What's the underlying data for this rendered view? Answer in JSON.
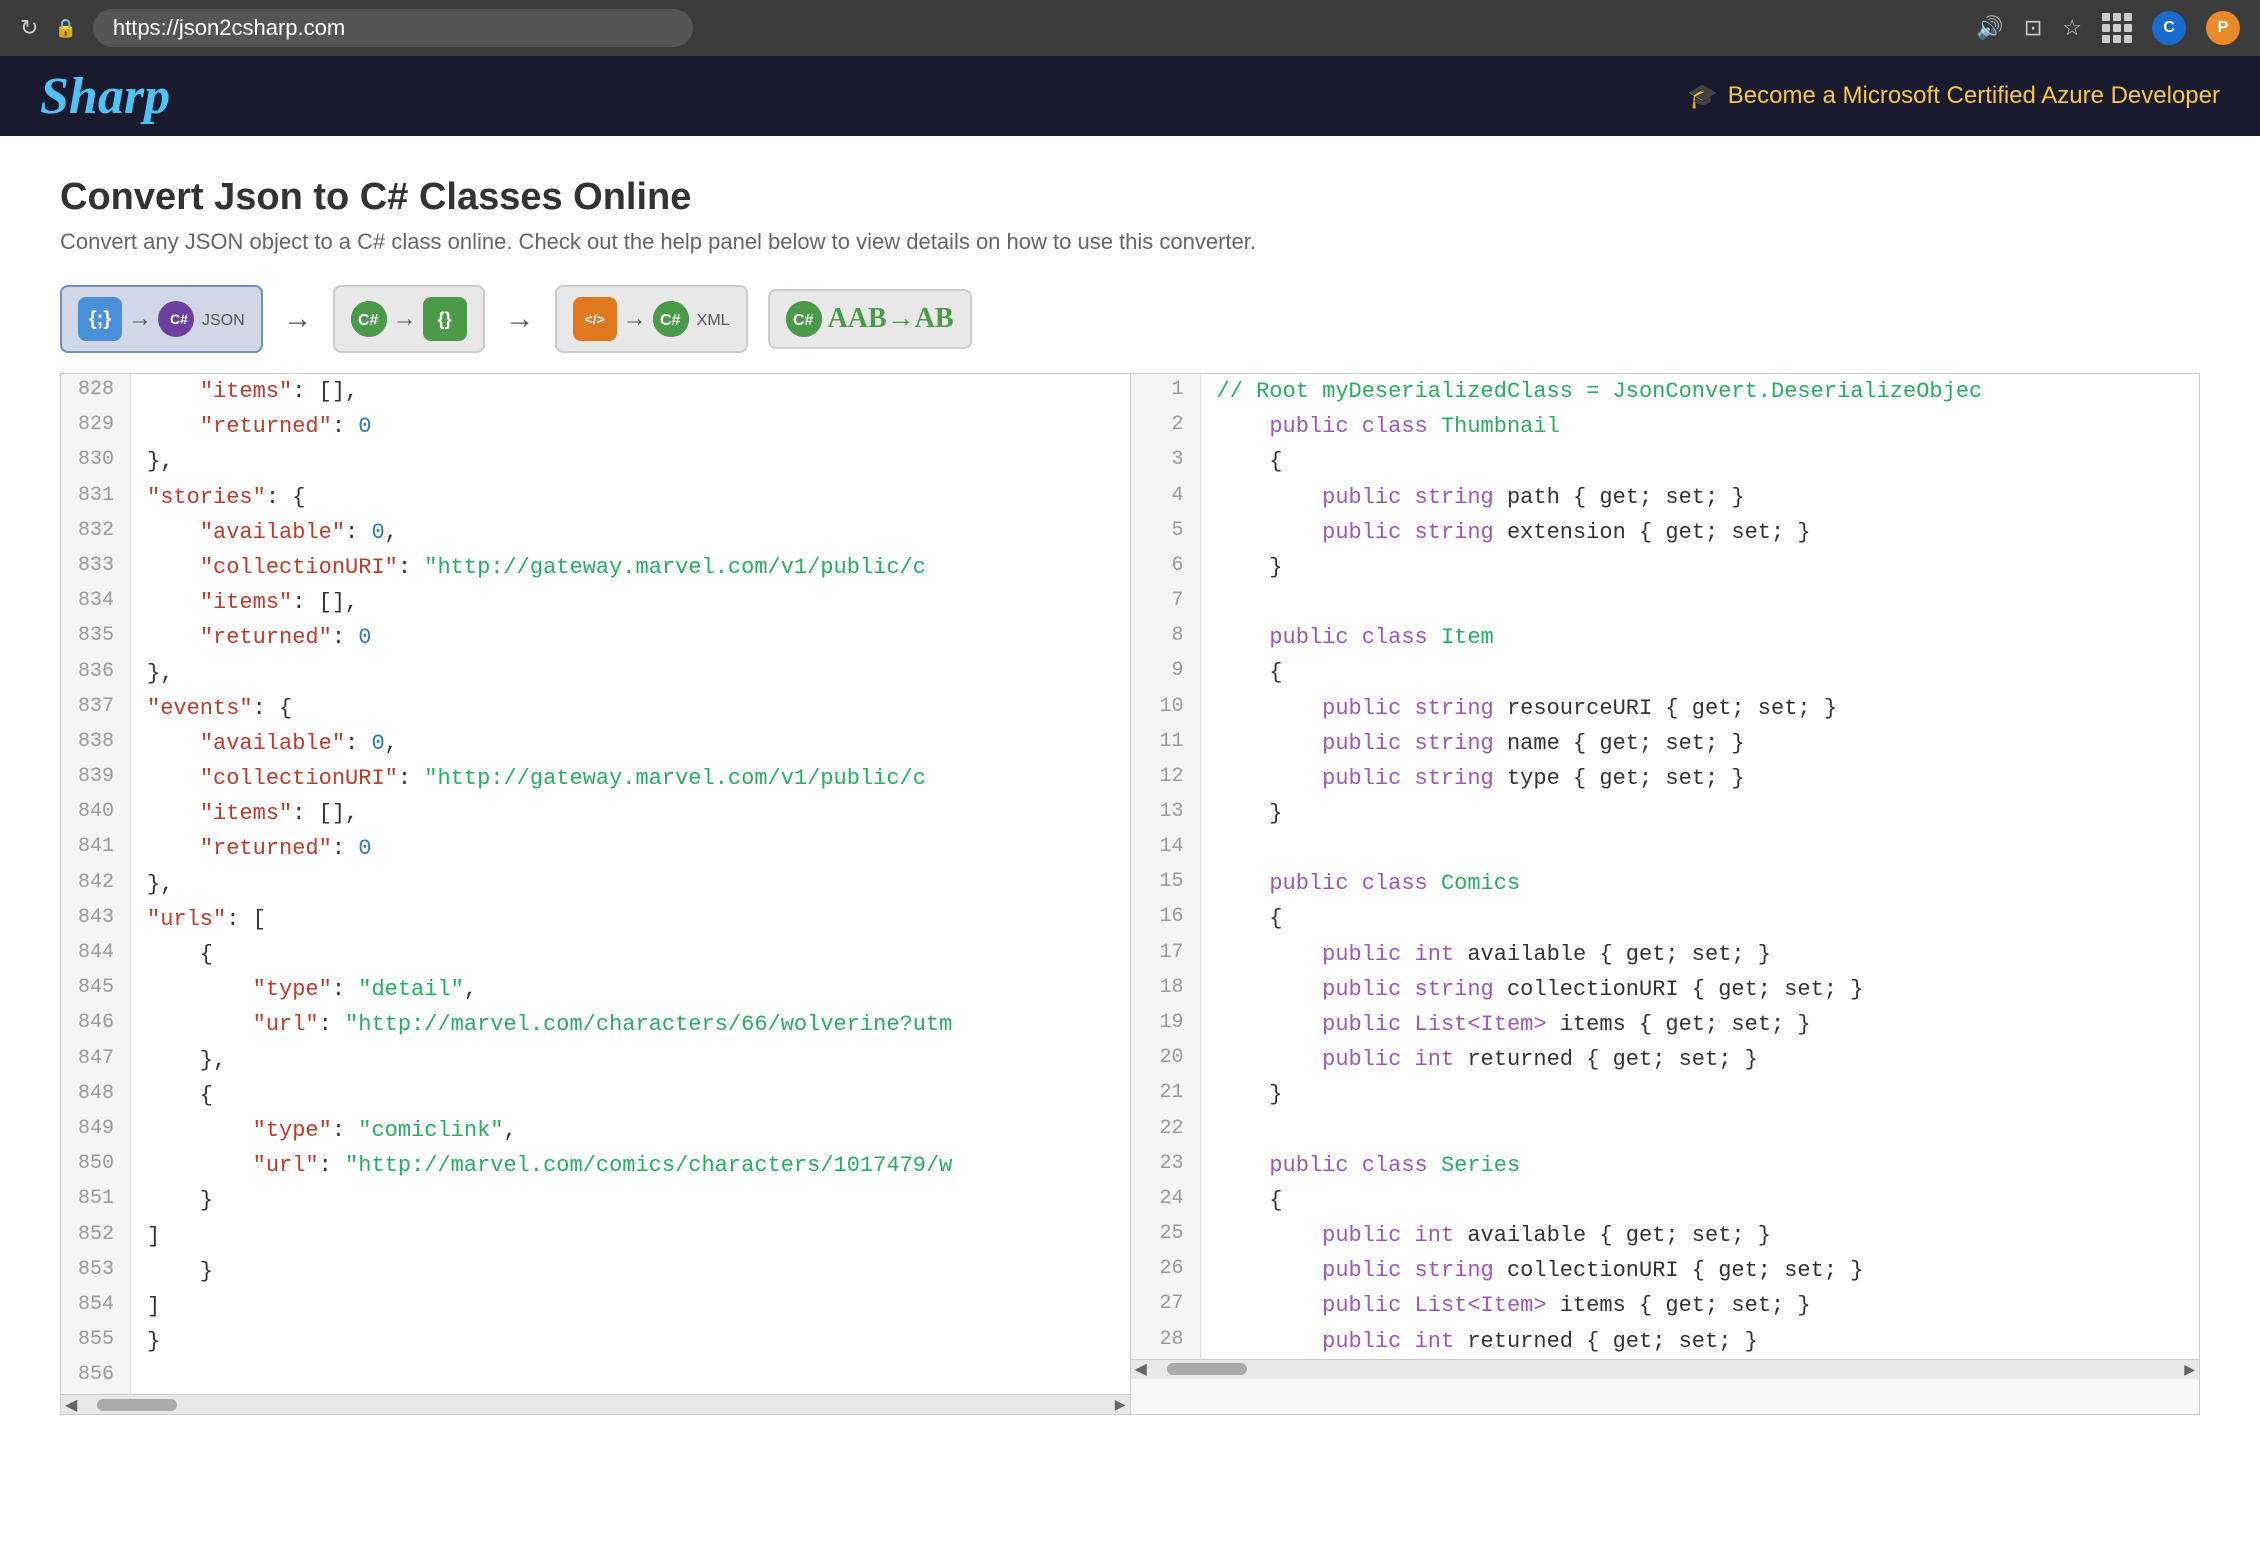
{
  "browser": {
    "url": "https://json2csharp.com",
    "refresh_icon": "↻",
    "lock_icon": "🔒",
    "tab_icons": [
      "⭐",
      "⋮⋮⋮"
    ],
    "avatar_c_label": "C",
    "avatar_p_label": "P"
  },
  "header": {
    "logo": "Sharp",
    "promo_icon": "🎓",
    "promo_text": "Become a Microsoft Certified Azure Developer"
  },
  "page": {
    "title": "Convert Json to C# Classes Online",
    "subtitle": "Convert any JSON object to a C# class online. Check out the help panel below to view details on how to use this converter."
  },
  "toolbar": {
    "btn1_label": "JSON",
    "btn1_arrow": "→",
    "btn2_label": "C#",
    "btn2_arrow": "→",
    "btn3_label": "C#",
    "btn4_label": "XML",
    "btn4_arrow": "→",
    "btn5_label": "C#",
    "rename_label": "AAB→AB"
  },
  "json_lines": [
    {
      "num": "828",
      "code": "    \"items\": [],"
    },
    {
      "num": "829",
      "code": "    \"returned\": 0"
    },
    {
      "num": "830",
      "code": "},"
    },
    {
      "num": "831",
      "code": "\"stories\": {"
    },
    {
      "num": "832",
      "code": "    \"available\": 0,"
    },
    {
      "num": "833",
      "code": "    \"collectionURI\": \"http://gateway.marvel.com/v1/public/c"
    },
    {
      "num": "834",
      "code": "    \"items\": [],"
    },
    {
      "num": "835",
      "code": "    \"returned\": 0"
    },
    {
      "num": "836",
      "code": "},"
    },
    {
      "num": "837",
      "code": "\"events\": {"
    },
    {
      "num": "838",
      "code": "    \"available\": 0,"
    },
    {
      "num": "839",
      "code": "    \"collectionURI\": \"http://gateway.marvel.com/v1/public/c"
    },
    {
      "num": "840",
      "code": "    \"items\": [],"
    },
    {
      "num": "841",
      "code": "    \"returned\": 0"
    },
    {
      "num": "842",
      "code": "},"
    },
    {
      "num": "843",
      "code": "\"urls\": ["
    },
    {
      "num": "844",
      "code": "    {"
    },
    {
      "num": "845",
      "code": "        \"type\": \"detail\","
    },
    {
      "num": "846",
      "code": "        \"url\": \"http://marvel.com/characters/66/wolverine?utm"
    },
    {
      "num": "847",
      "code": "    },"
    },
    {
      "num": "848",
      "code": "    {"
    },
    {
      "num": "849",
      "code": "        \"type\": \"comiclink\","
    },
    {
      "num": "850",
      "code": "        \"url\": \"http://marvel.com/comics/characters/1017479/w"
    },
    {
      "num": "851",
      "code": "    }"
    },
    {
      "num": "852",
      "code": "]"
    },
    {
      "num": "853",
      "code": "    }"
    },
    {
      "num": "854",
      "code": "]"
    },
    {
      "num": "855",
      "code": "}"
    },
    {
      "num": "856",
      "code": ""
    }
  ],
  "cs_lines": [
    {
      "num": "1",
      "code": "// Root myDeserializedClass = JsonConvert.DeserializeObjec"
    },
    {
      "num": "2",
      "code": "    public class Thumbnail"
    },
    {
      "num": "3",
      "code": "    {"
    },
    {
      "num": "4",
      "code": "        public string path { get; set; }"
    },
    {
      "num": "5",
      "code": "        public string extension { get; set; }"
    },
    {
      "num": "6",
      "code": "    }"
    },
    {
      "num": "7",
      "code": ""
    },
    {
      "num": "8",
      "code": "    public class Item"
    },
    {
      "num": "9",
      "code": "    {"
    },
    {
      "num": "10",
      "code": "        public string resourceURI { get; set; }"
    },
    {
      "num": "11",
      "code": "        public string name { get; set; }"
    },
    {
      "num": "12",
      "code": "        public string type { get; set; }"
    },
    {
      "num": "13",
      "code": "    }"
    },
    {
      "num": "14",
      "code": ""
    },
    {
      "num": "15",
      "code": "    public class Comics"
    },
    {
      "num": "16",
      "code": "    {"
    },
    {
      "num": "17",
      "code": "        public int available { get; set; }"
    },
    {
      "num": "18",
      "code": "        public string collectionURI { get; set; }"
    },
    {
      "num": "19",
      "code": "        public List<Item> items { get; set; }"
    },
    {
      "num": "20",
      "code": "        public int returned { get; set; }"
    },
    {
      "num": "21",
      "code": "    }"
    },
    {
      "num": "22",
      "code": ""
    },
    {
      "num": "23",
      "code": "    public class Series"
    },
    {
      "num": "24",
      "code": "    {"
    },
    {
      "num": "25",
      "code": "        public int available { get; set; }"
    },
    {
      "num": "26",
      "code": "        public string collectionURI { get; set; }"
    },
    {
      "num": "27",
      "code": "        public List<Item> items { get; set; }"
    },
    {
      "num": "28",
      "code": "        public int returned { get; set; }"
    }
  ]
}
